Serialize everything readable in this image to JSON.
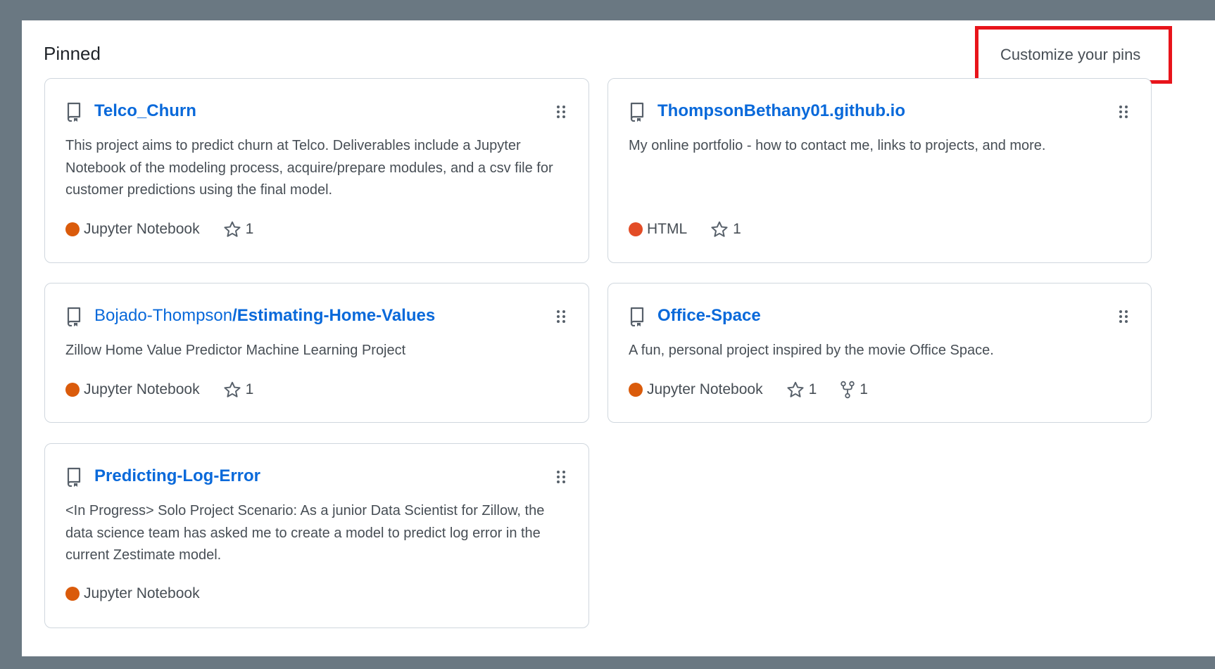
{
  "section": {
    "title": "Pinned",
    "customize_label": "Customize your pins"
  },
  "pins": [
    {
      "owner": "",
      "name": "Telco_Churn",
      "description": "This project aims to predict churn at Telco. Deliverables include a Jupyter Notebook of the modeling process, acquire/prepare modules, and a csv file for customer predictions using the final model.",
      "language": "Jupyter Notebook",
      "language_color": "#DA5B0B",
      "stars": "1"
    },
    {
      "owner": "",
      "name": "ThompsonBethany01.github.io",
      "description": "My online portfolio - how to contact me, links to projects, and more.",
      "language": "HTML",
      "language_color": "#e34c26",
      "stars": "1"
    },
    {
      "owner": "Bojado-Thompson",
      "name": "Estimating-Home-Values",
      "description": "Zillow Home Value Predictor Machine Learning Project",
      "language": "Jupyter Notebook",
      "language_color": "#DA5B0B",
      "stars": "1"
    },
    {
      "owner": "",
      "name": "Office-Space",
      "description": "A fun, personal project inspired by the movie Office Space.",
      "language": "Jupyter Notebook",
      "language_color": "#DA5B0B",
      "stars": "1",
      "forks": "1"
    },
    {
      "owner": "",
      "name": "Predicting-Log-Error",
      "description": "<In Progress> Solo Project Scenario: As a junior Data Scientist for Zillow, the data science team has asked me to create a model to predict log error in the current Zestimate model.",
      "language": "Jupyter Notebook",
      "language_color": "#DA5B0B"
    }
  ],
  "icons": {
    "repo": "repo-icon",
    "drag": "grabber-icon",
    "star": "star-icon",
    "fork": "fork-icon"
  },
  "colors": {
    "link": "#0969da",
    "highlight": "#e8141b",
    "frame": "#6a7882"
  }
}
